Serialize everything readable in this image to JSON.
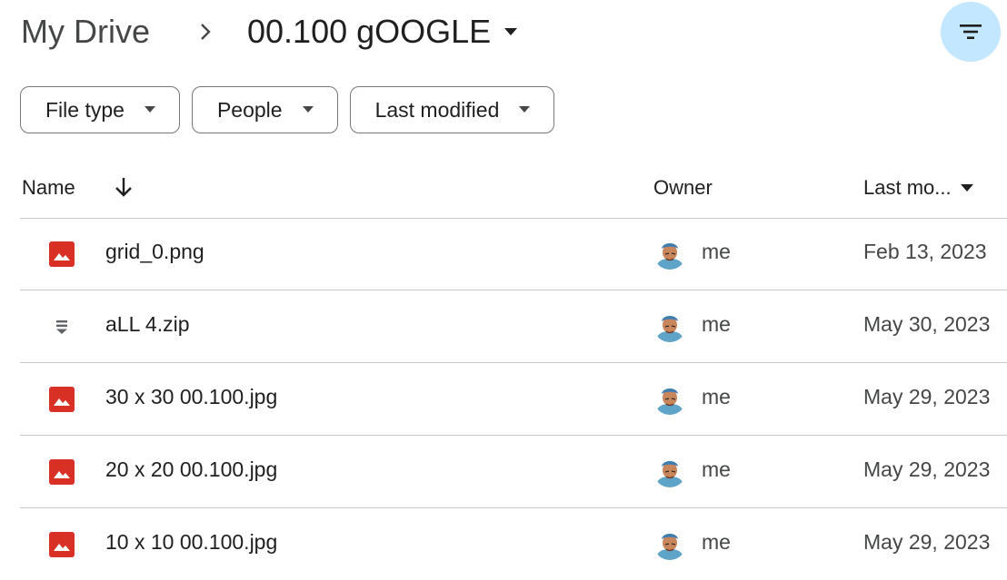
{
  "breadcrumb": {
    "root": "My Drive",
    "separator_icon": "chevron-right-icon",
    "current_folder": "00.100 gOOGLE"
  },
  "toolbar": {
    "filter_icon": "filter-list-icon",
    "accent_color": "#c2e7ff"
  },
  "filter_chips": [
    {
      "label": "File type"
    },
    {
      "label": "People"
    },
    {
      "label": "Last modified"
    }
  ],
  "table": {
    "columns": {
      "name": "Name",
      "owner": "Owner",
      "last_modified": "Last mo..."
    },
    "sort": {
      "column": "name",
      "direction": "descending-arrow"
    },
    "rows": [
      {
        "name": "grid_0.png",
        "type": "image",
        "owner": "me",
        "modified": "Feb 13, 2023"
      },
      {
        "name": "aLL 4.zip",
        "type": "zip",
        "owner": "me",
        "modified": "May 30, 2023"
      },
      {
        "name": "30 x 30 00.100.jpg",
        "type": "image",
        "owner": "me",
        "modified": "May 29, 2023"
      },
      {
        "name": "20 x 20 00.100.jpg",
        "type": "image",
        "owner": "me",
        "modified": "May 29, 2023"
      },
      {
        "name": "10 x 10 00.100.jpg",
        "type": "image",
        "owner": "me",
        "modified": "May 29, 2023"
      }
    ]
  },
  "colors": {
    "image_icon": "#d93025",
    "zip_icon": "#5f6368",
    "divider": "#c7c7c7"
  }
}
